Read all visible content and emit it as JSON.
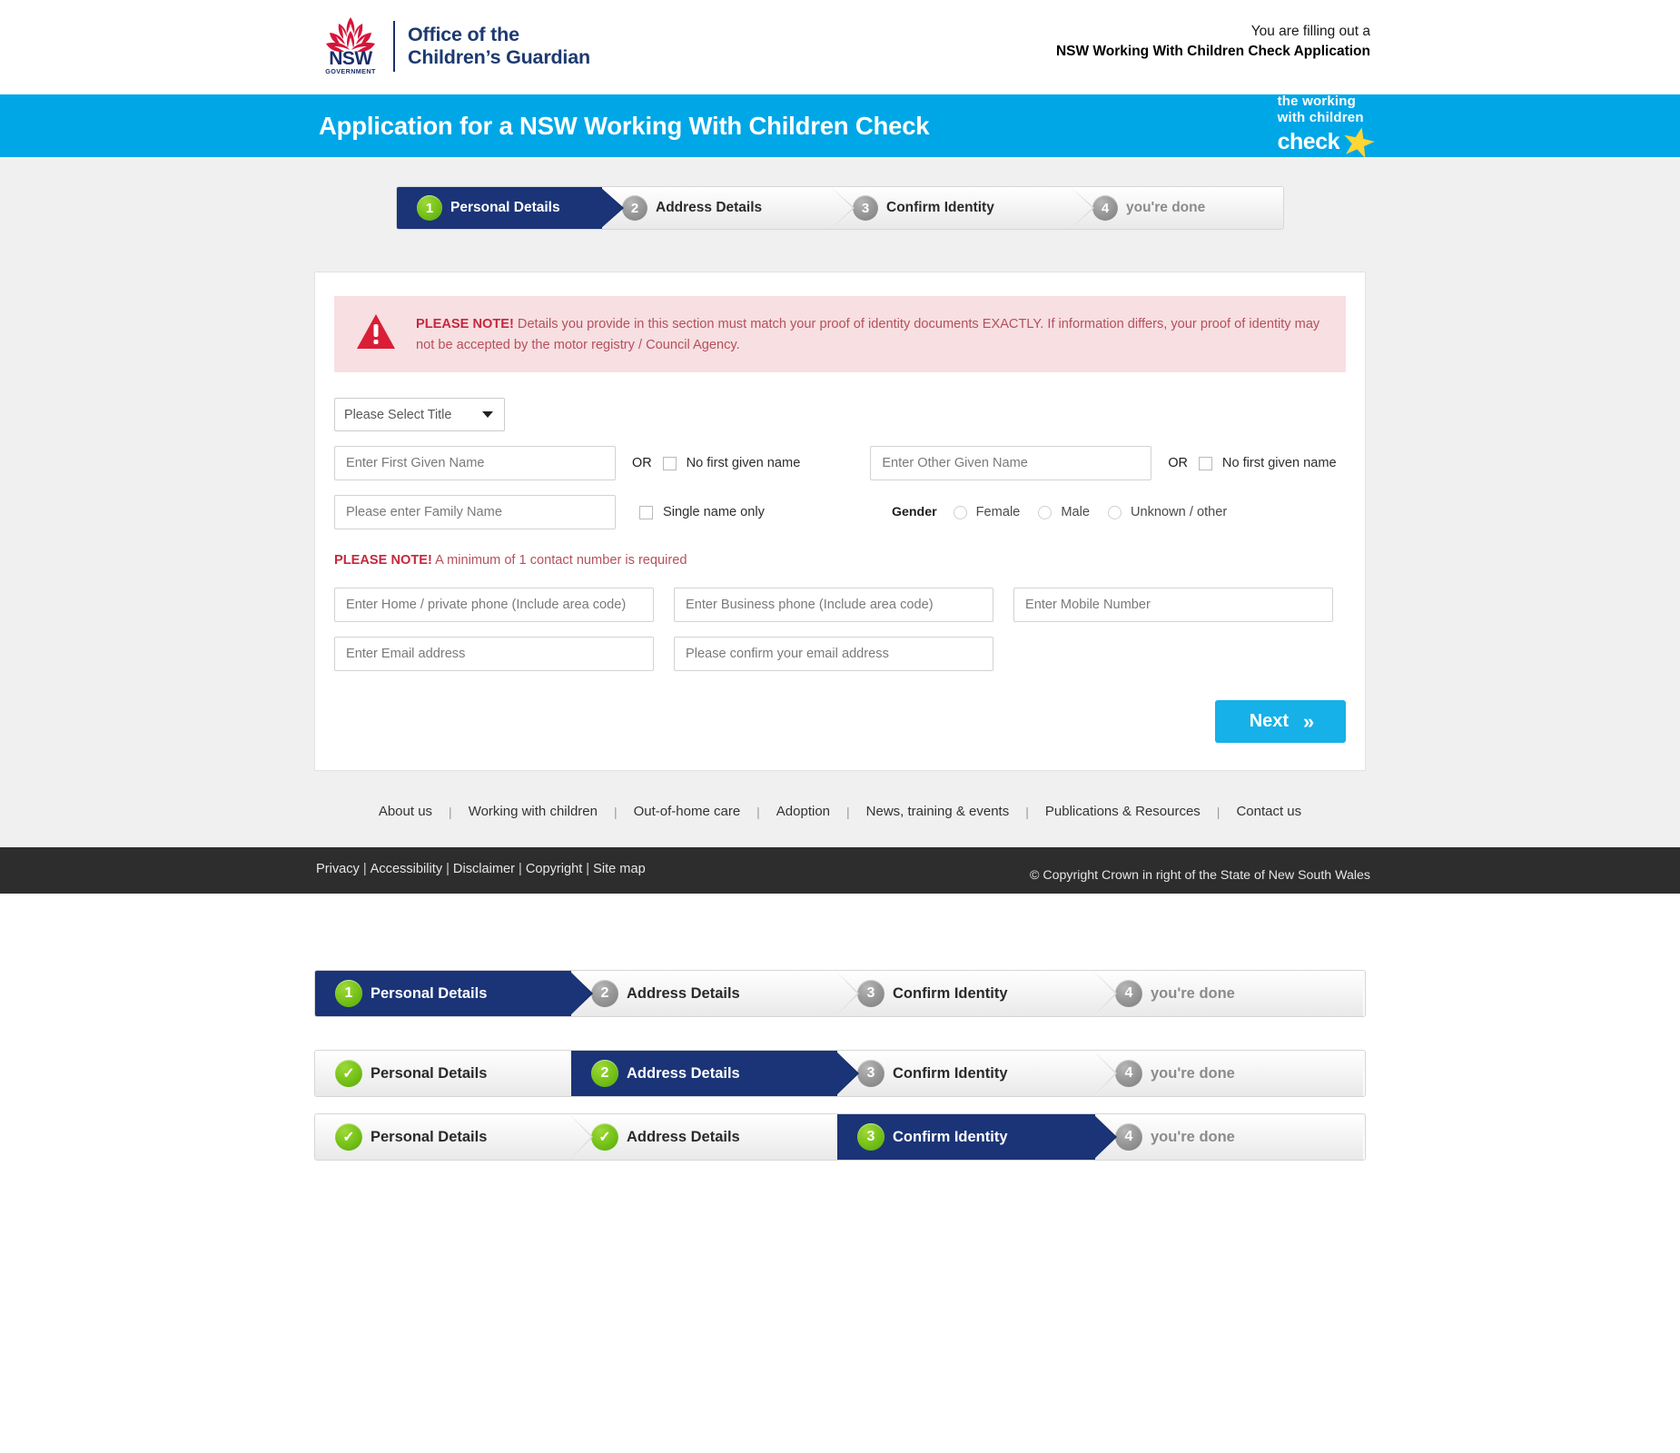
{
  "header": {
    "logo": {
      "nsw_big": "NSW",
      "nsw_small": "GOVERNMENT",
      "agency_line1": "Office of the",
      "agency_line2": "Children’s Guardian"
    },
    "filling_out_line1": "You are filling out a",
    "filling_out_line2": "NSW Working With Children Check Application"
  },
  "banner": {
    "title": "Application for a NSW Working With Children Check",
    "wwc_logo": {
      "line1": "the working",
      "line2": "with children",
      "line3": "check",
      "star_color": "#ffd633"
    },
    "background_color": "#00a7e6"
  },
  "steps": {
    "bar_primary": [
      {
        "number": "1",
        "label": "Personal Details",
        "state": "active"
      },
      {
        "number": "2",
        "label": "Address Details",
        "state": "pending"
      },
      {
        "number": "3",
        "label": "Confirm Identity",
        "state": "pending"
      },
      {
        "number": "4",
        "label": "you're done",
        "state": "muted"
      }
    ],
    "sample_bar_1": [
      {
        "number": "1",
        "label": "Personal Details",
        "state": "active"
      },
      {
        "number": "2",
        "label": "Address Details",
        "state": "pending"
      },
      {
        "number": "3",
        "label": "Confirm Identity",
        "state": "pending"
      },
      {
        "number": "4",
        "label": "you're done",
        "state": "muted"
      }
    ],
    "sample_bar_2": [
      {
        "number": "✓",
        "label": "Personal Details",
        "state": "complete"
      },
      {
        "number": "2",
        "label": "Address Details",
        "state": "active"
      },
      {
        "number": "3",
        "label": "Confirm Identity",
        "state": "pending"
      },
      {
        "number": "4",
        "label": "you're done",
        "state": "muted"
      }
    ],
    "sample_bar_3": [
      {
        "number": "✓",
        "label": "Personal Details",
        "state": "complete"
      },
      {
        "number": "✓",
        "label": "Address Details",
        "state": "complete"
      },
      {
        "number": "3",
        "label": "Confirm Identity",
        "state": "active"
      },
      {
        "number": "4",
        "label": "you're done",
        "state": "muted"
      }
    ],
    "colors": {
      "active_bg": "#1b3477",
      "complete_circle": "#79c41b",
      "pending_circle": "#9a9a9a"
    }
  },
  "form": {
    "alert": {
      "strong": "PLEASE NOTE!",
      "text": " Details you provide in this section must match your proof of identity documents EXACTLY. If information differs, your proof of identity may not be accepted by the motor registry / Council Agency.",
      "icon": "warning-triangle-icon",
      "bg_color": "#f7dfe2",
      "text_color": "#b5505c"
    },
    "title_select": {
      "value": "Please Select Title"
    },
    "first_given_name": {
      "placeholder": "Enter First Given Name"
    },
    "first_given_or": "OR",
    "first_given_no_name_label": "No first given name",
    "other_given_name": {
      "placeholder": "Enter Other Given Name"
    },
    "other_given_or": "OR",
    "other_given_no_name_label": "No first given name",
    "family_name": {
      "placeholder": "Please enter Family Name"
    },
    "single_name_label": "Single name only",
    "gender": {
      "label": "Gender",
      "options": [
        "Female",
        "Male",
        "Unknown / other"
      ]
    },
    "contact_note": {
      "strong": "PLEASE NOTE!",
      "text": " A minimum of 1 contact number is required"
    },
    "home_phone": {
      "placeholder": "Enter Home / private phone (Include area code)"
    },
    "business_phone": {
      "placeholder": "Enter Business phone (Include area code)"
    },
    "mobile_number": {
      "placeholder": "Enter Mobile Number"
    },
    "email": {
      "placeholder": "Enter Email address"
    },
    "email_confirm": {
      "placeholder": "Please confirm your email address"
    },
    "next_button": {
      "label": "Next",
      "icon": "double-chevron-right-icon",
      "color": "#16b1e8"
    }
  },
  "footer_nav": [
    "About us",
    "Working with children",
    "Out-of-home care",
    "Adoption",
    "News, training & events",
    "Publications & Resources",
    "Contact us"
  ],
  "footer_nav_separator": "|",
  "dark_footer": {
    "links": [
      "Privacy",
      "Accessibility",
      "Disclaimer",
      "Copyright",
      "Site map"
    ],
    "separator": "|",
    "copyright": "© Copyright Crown in right of the State of New South Wales",
    "background_color": "#2d2d2d"
  }
}
